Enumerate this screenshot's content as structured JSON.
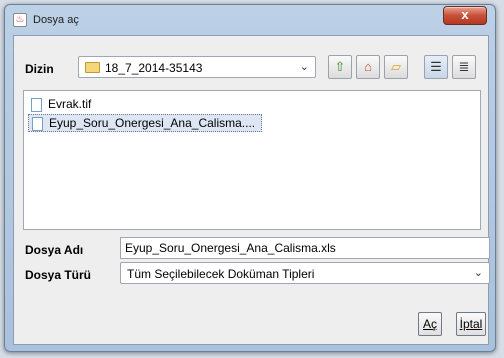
{
  "dialog": {
    "title": "Dosya aç",
    "close_label": "x"
  },
  "look_in": {
    "label": "Dizin",
    "value": "18_7_2014-35143"
  },
  "toolbar": {
    "icons": [
      "up-folder-icon",
      "home-icon",
      "new-folder-icon",
      "list-view-icon",
      "details-view-icon"
    ]
  },
  "files": [
    {
      "name": "Evrak.tif"
    },
    {
      "name": "Eyup_Soru_Onergesi_Ana_Calisma...."
    }
  ],
  "file_name": {
    "label": "Dosya Adı",
    "value": "Eyup_Soru_Onergesi_Ana_Calisma.xls"
  },
  "file_type": {
    "label": "Dosya Türü",
    "value": "Tüm Seçilebilecek Doküman Tipleri"
  },
  "buttons": {
    "open": "Aç",
    "cancel": "İptal"
  }
}
